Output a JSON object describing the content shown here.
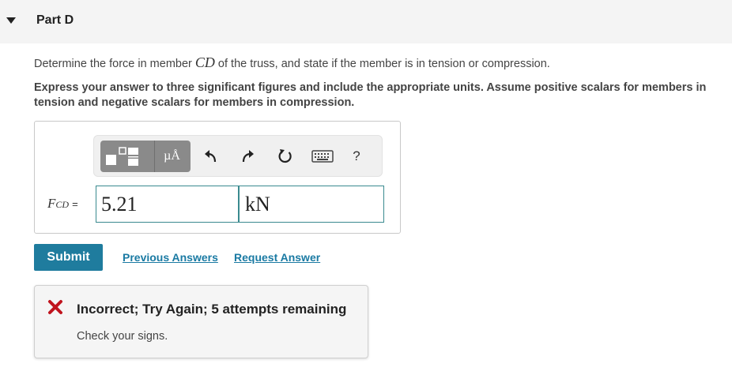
{
  "part": {
    "title": "Part D"
  },
  "question": {
    "prefix": "Determine the force in member ",
    "member": "CD",
    "suffix": " of the truss, and state if the member is in tension or compression.",
    "instructions": "Express your answer to three significant figures and include the appropriate units. Assume positive scalars for members in tension and negative scalars for members in compression."
  },
  "toolbar": {
    "units_button_label": "µÅ",
    "help_label": "?",
    "icons": [
      "templates-icon",
      "undo-icon",
      "redo-icon",
      "reset-icon",
      "keyboard-icon",
      "help-icon"
    ]
  },
  "answer": {
    "variable": "F",
    "subscript": "CD",
    "equals": "=",
    "value": "5.21",
    "units": "kN"
  },
  "actions": {
    "submit_label": "Submit",
    "previous_answers_label": "Previous Answers",
    "request_answer_label": "Request Answer"
  },
  "feedback": {
    "title": "Incorrect; Try Again; 5 attempts remaining",
    "message": "Check your signs.",
    "icon": "x-mark-icon",
    "icon_color": "#c0141e"
  },
  "colors": {
    "accent": "#1f7c9e",
    "link": "#1a7aa3",
    "field_border": "#3a8a8f"
  }
}
